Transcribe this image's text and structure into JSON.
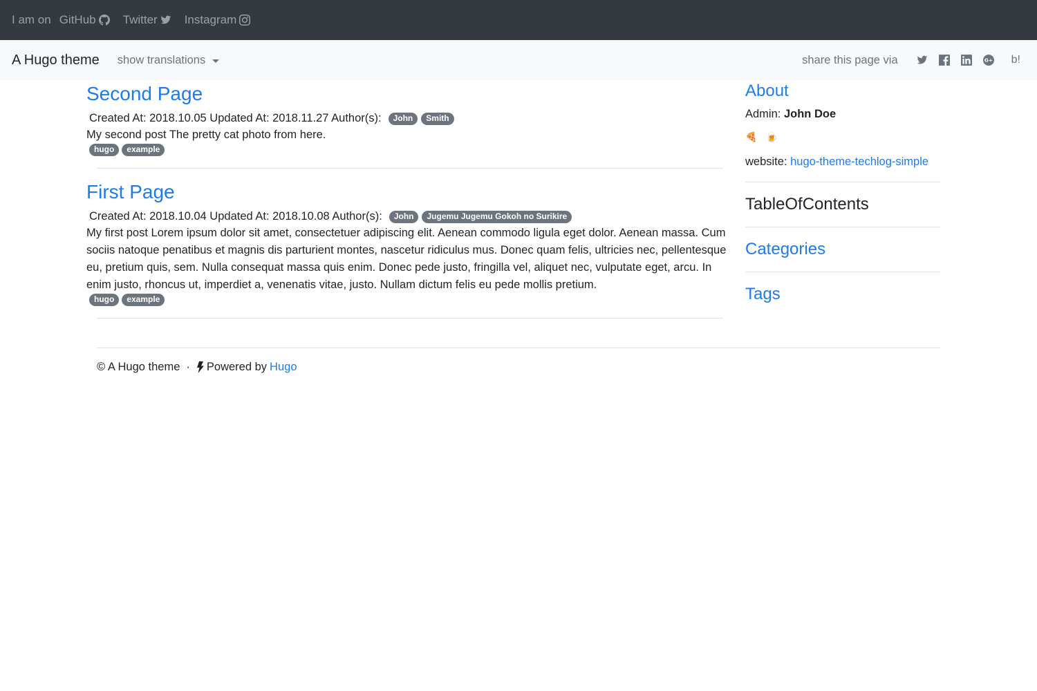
{
  "topbar": {
    "intro": "I am on",
    "links": [
      {
        "label": "GitHub",
        "icon": "github-icon"
      },
      {
        "label": "Twitter",
        "icon": "twitter-icon"
      },
      {
        "label": "Instagram",
        "icon": "instagram-icon"
      }
    ]
  },
  "navbar": {
    "brand": "A Hugo theme",
    "translations": "show translations",
    "share_label": "share this page via",
    "share_icons": [
      "twitter-icon",
      "facebook-icon",
      "linkedin-icon",
      "google-plus-icon"
    ],
    "hatena": "b!"
  },
  "posts": [
    {
      "title": "Second Page",
      "meta": "Created At: 2018.10.05 Updated At: 2018.11.27 Author(s):",
      "authors": [
        "John",
        "Smith"
      ],
      "excerpt": "My second post The pretty cat photo from here.",
      "tags": [
        "hugo",
        "example"
      ]
    },
    {
      "title": "First Page",
      "meta": "Created At: 2018.10.04 Updated At: 2018.10.08 Author(s):",
      "authors": [
        "John",
        "Jugemu Jugemu Gokoh no Surikire"
      ],
      "excerpt": "My first post Lorem ipsum dolor sit amet, consectetuer adipiscing elit. Aenean commodo ligula eget dolor. Aenean massa. Cum sociis natoque penatibus et magnis dis parturient montes, nascetur ridiculus mus. Donec quam felis, ultricies nec, pellentesque eu, pretium quis, sem. Nulla consequat massa quis enim. Donec pede justo, fringilla vel, aliquet nec, vulputate eget, arcu. In enim justo, rhoncus ut, imperdiet a, venenatis vitae, justo. Nullam dictum felis eu pede mollis pretium.",
      "tags": [
        "hugo",
        "example"
      ]
    }
  ],
  "sidebar": {
    "about_title": "About",
    "admin_label": "Admin:",
    "admin_name": "John Doe",
    "emojis": [
      "🍕",
      "🍺"
    ],
    "website_label": "website:",
    "website_link": "hugo-theme-techlog-simple",
    "toc_title": "TableOfContents",
    "categories_title": "Categories",
    "tags_title": "Tags"
  },
  "footer": {
    "copyright": "© A Hugo theme",
    "separator": "·",
    "powered": "Powered by",
    "hugo_link": "Hugo"
  },
  "colors": {
    "topbar_bg": "#343a40",
    "navbar_bg": "#f8f9fa",
    "link": "#1e7bef",
    "badge": "#6c757d"
  }
}
